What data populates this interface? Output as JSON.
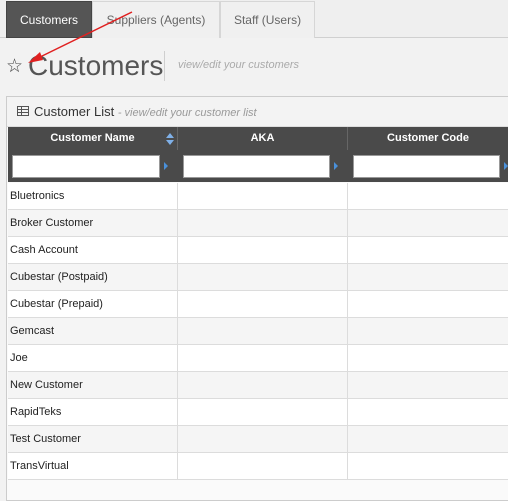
{
  "tabs": [
    {
      "label": "Customers",
      "active": true
    },
    {
      "label": "Suppliers (Agents)",
      "active": false
    },
    {
      "label": "Staff (Users)",
      "active": false
    }
  ],
  "page": {
    "title": "Customers",
    "subtitle": "view/edit your customers",
    "star_icon": "star-outline-icon"
  },
  "widget": {
    "icon": "table-grid-icon",
    "title": "Customer List",
    "subtitle": "- view/edit your customer list"
  },
  "table": {
    "columns": [
      "Customer Name",
      "AKA",
      "Customer Code"
    ],
    "sort_icon": "sort-arrows-icon",
    "filters": [
      "",
      "",
      ""
    ],
    "rows": [
      [
        "Bluetronics",
        "",
        ""
      ],
      [
        "Broker Customer",
        "",
        ""
      ],
      [
        "Cash Account",
        "",
        ""
      ],
      [
        "Cubestar (Postpaid)",
        "",
        ""
      ],
      [
        "Cubestar (Prepaid)",
        "",
        ""
      ],
      [
        "Gemcast",
        "",
        ""
      ],
      [
        "Joe",
        "",
        ""
      ],
      [
        "New Customer",
        "",
        ""
      ],
      [
        "RapidTeks",
        "",
        ""
      ],
      [
        "Test Customer",
        "",
        ""
      ],
      [
        "TransVirtual",
        "",
        ""
      ]
    ]
  },
  "colors": {
    "active_tab": "#555555",
    "table_header": "#4a4a4a",
    "annotation_arrow": "#e02020",
    "filter_marker": "#4a90d9"
  }
}
